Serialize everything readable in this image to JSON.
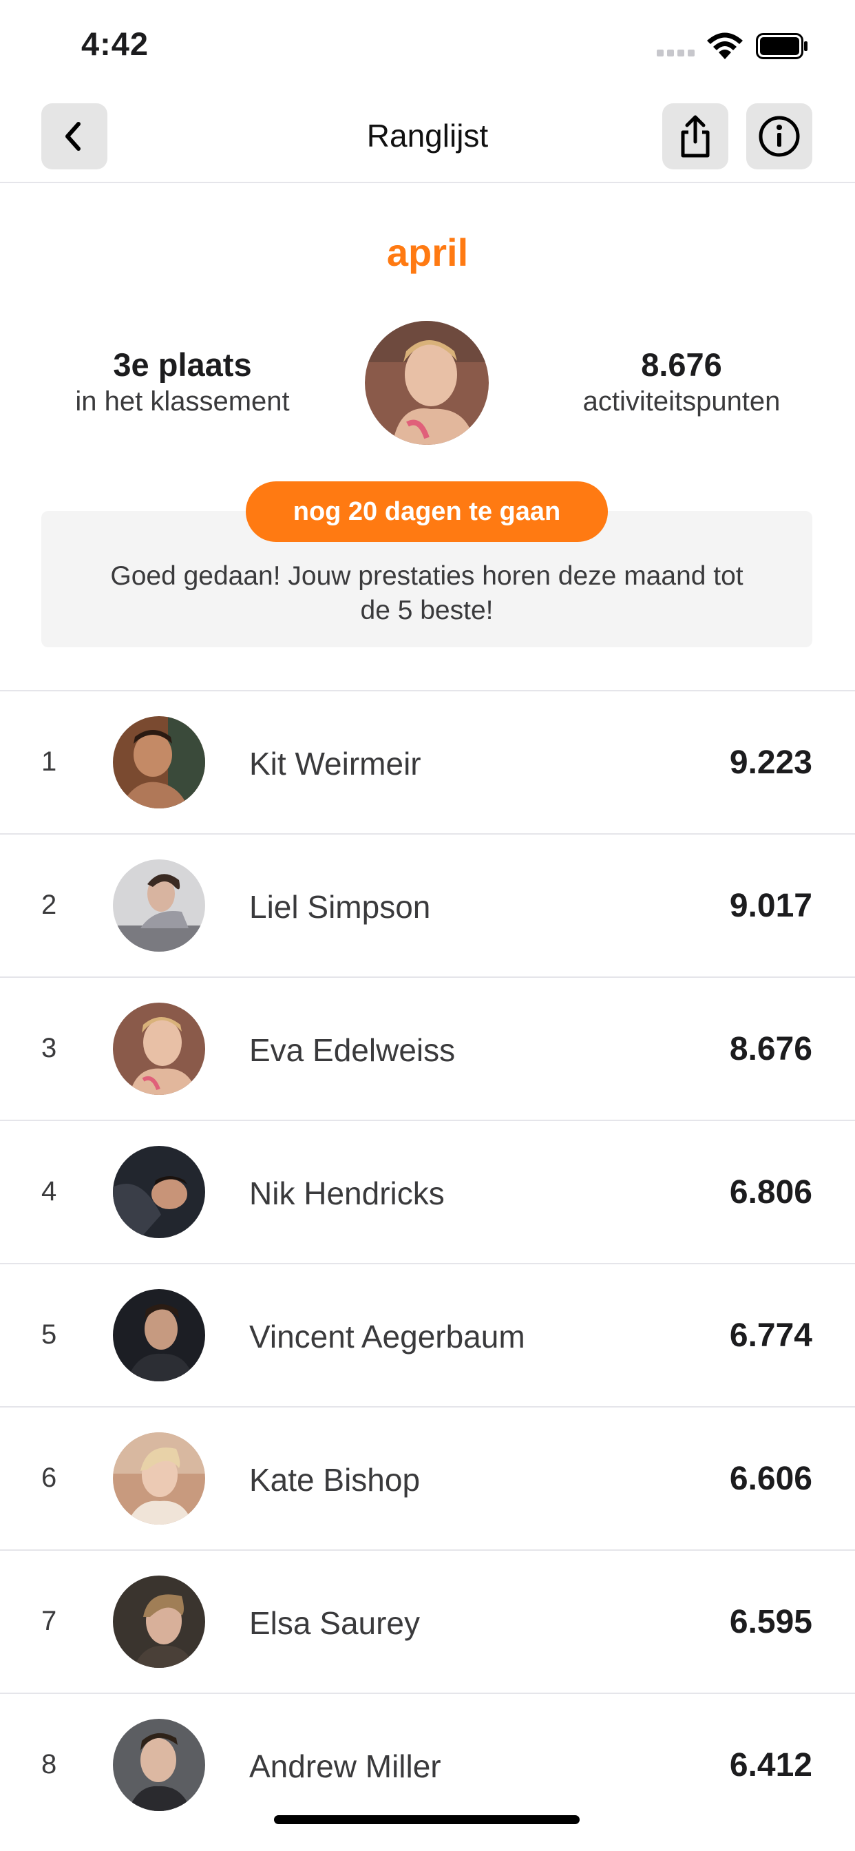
{
  "status_bar": {
    "time": "4:42"
  },
  "nav": {
    "title": "Ranglijst",
    "back_icon": "chevron-left-icon",
    "share_icon": "share-icon",
    "info_icon": "info-circle-icon"
  },
  "summary": {
    "month": "april",
    "place": "3e plaats",
    "place_sub": "in het klassement",
    "points": "8.676",
    "points_sub": "activiteitspunten",
    "badge": "nog 20 dagen te gaan",
    "message": "Goed gedaan! Jouw prestaties horen deze maand tot de 5 beste!"
  },
  "leaderboard": [
    {
      "rank": "1",
      "name": "Kit Weirmeir",
      "score": "9.223"
    },
    {
      "rank": "2",
      "name": "Liel Simpson",
      "score": "9.017"
    },
    {
      "rank": "3",
      "name": "Eva Edelweiss",
      "score": "8.676"
    },
    {
      "rank": "4",
      "name": "Nik Hendricks",
      "score": "6.806"
    },
    {
      "rank": "5",
      "name": "Vincent Aegerbaum",
      "score": "6.774"
    },
    {
      "rank": "6",
      "name": "Kate Bishop",
      "score": "6.606"
    },
    {
      "rank": "7",
      "name": "Elsa Saurey",
      "score": "6.595"
    },
    {
      "rank": "8",
      "name": "Andrew Miller",
      "score": "6.412"
    }
  ],
  "colors": {
    "accent": "#ff7a12",
    "panel": "#f4f4f4",
    "divider": "#e5e5ea"
  }
}
